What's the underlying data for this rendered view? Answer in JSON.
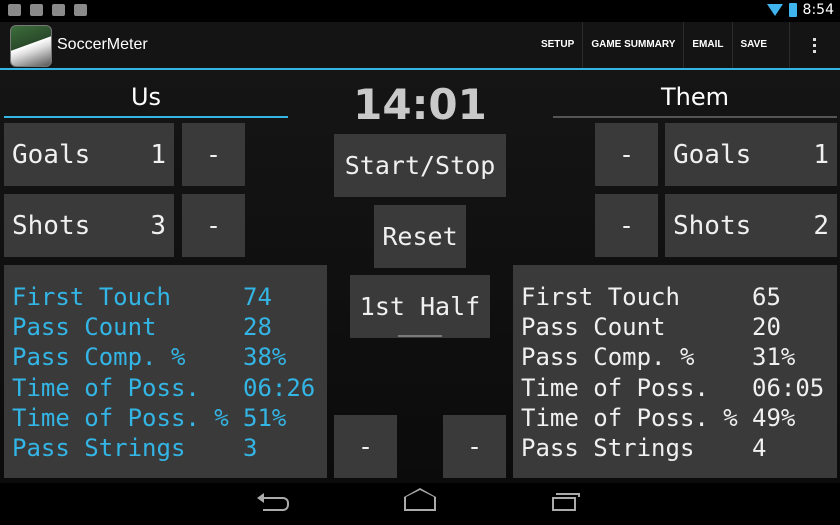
{
  "status_bar": {
    "time": "8:54",
    "left_icons": [
      "mail-icon",
      "sdcard-icon",
      "play-store-icon",
      "android-icon"
    ],
    "right_icons": [
      "wifi-icon",
      "battery-icon"
    ],
    "accent": "#33b5e5"
  },
  "action_bar": {
    "app_title": "SoccerMeter",
    "actions": [
      "SETUP",
      "GAME SUMMARY",
      "EMAIL",
      "SAVE"
    ],
    "overflow_icon": "overflow-menu-icon"
  },
  "us": {
    "header": "Us",
    "goals_label": "Goals",
    "goals_value": "1",
    "shots_label": "Shots",
    "shots_value": "3",
    "minus": "-",
    "stats": [
      {
        "label": "First Touch",
        "value": "74"
      },
      {
        "label": "Pass Count",
        "value": "28"
      },
      {
        "label": "Pass Comp. %",
        "value": "38%"
      },
      {
        "label": "Time of Poss.",
        "value": "06:26"
      },
      {
        "label": "Time of Poss. %",
        "value": "51%"
      },
      {
        "label": "Pass Strings",
        "value": "3"
      }
    ]
  },
  "them": {
    "header": "Them",
    "goals_label": "Goals",
    "goals_value": "1",
    "shots_label": "Shots",
    "shots_value": "2",
    "minus": "-",
    "stats": [
      {
        "label": "First Touch",
        "value": "65"
      },
      {
        "label": "Pass Count",
        "value": "20"
      },
      {
        "label": "Pass Comp. %",
        "value": "31%"
      },
      {
        "label": "Time of Poss.",
        "value": "06:05"
      },
      {
        "label": "Time of Poss. %",
        "value": "49%"
      },
      {
        "label": "Pass Strings",
        "value": "4"
      }
    ]
  },
  "center": {
    "timer": "14:01",
    "start_stop": "Start/Stop",
    "reset": "Reset",
    "half": "1st Half",
    "minus_left": "-",
    "minus_right": "-"
  },
  "nav": {
    "icons": [
      "back-icon",
      "home-icon",
      "recent-apps-icon"
    ]
  }
}
